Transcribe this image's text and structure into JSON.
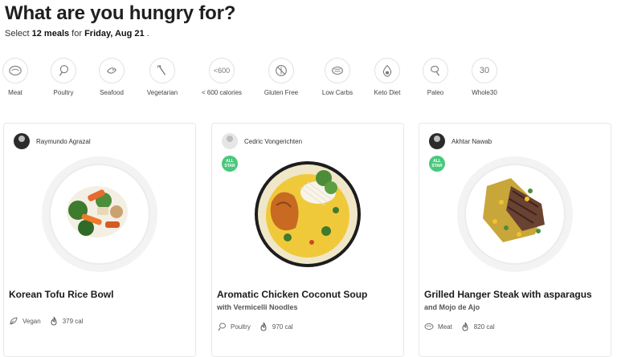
{
  "header": {
    "title": "What are you hungry for?",
    "select_prefix": "Select ",
    "count": "12 meals",
    "for_word": " for ",
    "date": "Friday, Aug 21",
    "suffix": " ."
  },
  "filters": [
    {
      "label": "Meat",
      "icon": "meat-icon"
    },
    {
      "label": "Poultry",
      "icon": "poultry-icon"
    },
    {
      "label": "Seafood",
      "icon": "seafood-icon"
    },
    {
      "label": "Vegetarian",
      "icon": "vegetarian-icon"
    },
    {
      "label": "< 600 calories",
      "icon": "calories-icon",
      "icon_text": "<600"
    },
    {
      "label": "Gluten Free",
      "icon": "gluten-free-icon"
    },
    {
      "label": "Low Carbs",
      "icon": "low-carbs-icon"
    },
    {
      "label": "Keto Diet",
      "icon": "keto-icon"
    },
    {
      "label": "Paleo",
      "icon": "paleo-icon"
    },
    {
      "label": "Whole30",
      "icon": "whole30-icon",
      "icon_text": "30"
    }
  ],
  "cards": [
    {
      "chef": "Raymundo Agrazal",
      "all_star": false,
      "title": "Korean Tofu Rice Bowl",
      "subtitle": "",
      "tag": "Vegan",
      "calories": "379 cal"
    },
    {
      "chef": "Cedric Vongerichten",
      "all_star": true,
      "badge_line1": "ALL",
      "badge_line2": "STAR",
      "title": "Aromatic Chicken Coconut Soup",
      "subtitle": "with Vermicelli Noodles",
      "tag": "Poultry",
      "calories": "970 cal"
    },
    {
      "chef": "Akhtar Nawab",
      "all_star": true,
      "badge_line1": "ALL",
      "badge_line2": "STAR",
      "title": "Grilled Hanger Steak with asparagus",
      "subtitle": "and Mojo de Ajo",
      "tag": "Meat",
      "calories": "820 cal"
    }
  ],
  "colors": {
    "accent_green": "#49c87c",
    "text": "#1f1f1f"
  }
}
